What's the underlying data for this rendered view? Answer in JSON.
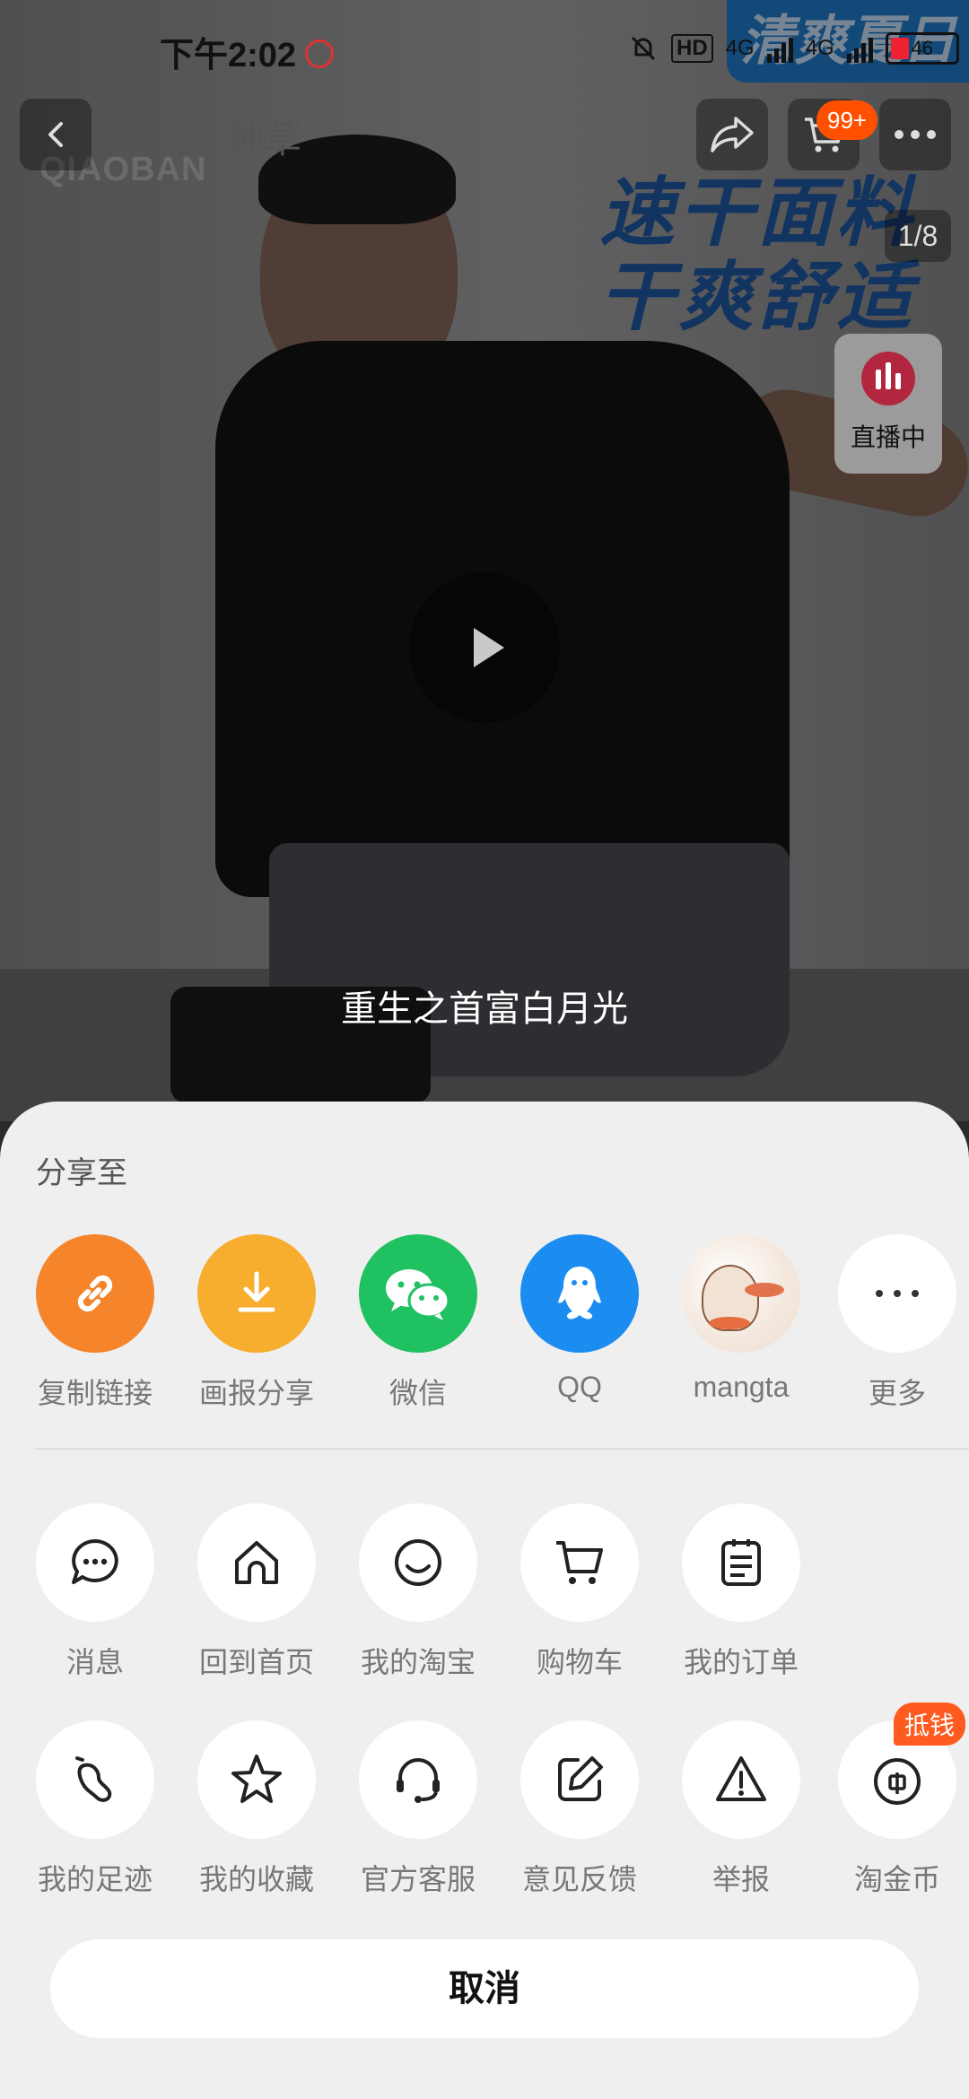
{
  "status_bar": {
    "time": "下午2:02",
    "hd_label": "HD",
    "net1": "4G",
    "net2": "4G",
    "battery": "46"
  },
  "nav": {
    "tabs": [
      "宝贝",
      "种草"
    ],
    "cart_badge": "99+",
    "page_indicator": "1/8",
    "live_label": "直播中"
  },
  "banner": {
    "corner_tag": "清爽夏日",
    "line1": "速干面料",
    "line2": "干爽舒适",
    "brand_watermark": "QIAOBAN"
  },
  "video": {
    "subtitle": "重生之首富白月光"
  },
  "share_sheet": {
    "title": "分享至",
    "share_targets": [
      {
        "label": "复制链接",
        "icon": "link-icon",
        "color": "#f5842a"
      },
      {
        "label": "画报分享",
        "icon": "download-icon",
        "color": "#f7ad2d"
      },
      {
        "label": "微信",
        "icon": "wechat-icon",
        "color": "#1fc160"
      },
      {
        "label": "QQ",
        "icon": "qq-icon",
        "color": "#1b8cf0"
      },
      {
        "label": "mangta",
        "icon": "avatar-icon",
        "color": "#f2e4d8"
      },
      {
        "label": "更多",
        "icon": "more-icon",
        "color": "#ffffff"
      }
    ],
    "actions_row1": [
      {
        "label": "消息",
        "icon": "message-icon"
      },
      {
        "label": "回到首页",
        "icon": "home-icon"
      },
      {
        "label": "我的淘宝",
        "icon": "smile-icon"
      },
      {
        "label": "购物车",
        "icon": "cart-icon"
      },
      {
        "label": "我的订单",
        "icon": "order-icon"
      }
    ],
    "actions_row2": [
      {
        "label": "我的足迹",
        "icon": "footprint-icon"
      },
      {
        "label": "我的收藏",
        "icon": "star-icon"
      },
      {
        "label": "官方客服",
        "icon": "headset-icon"
      },
      {
        "label": "意见反馈",
        "icon": "edit-icon"
      },
      {
        "label": "举报",
        "icon": "warning-icon"
      },
      {
        "label": "淘金币",
        "icon": "coin-icon",
        "badge": "抵钱"
      }
    ],
    "cancel_label": "取消"
  }
}
